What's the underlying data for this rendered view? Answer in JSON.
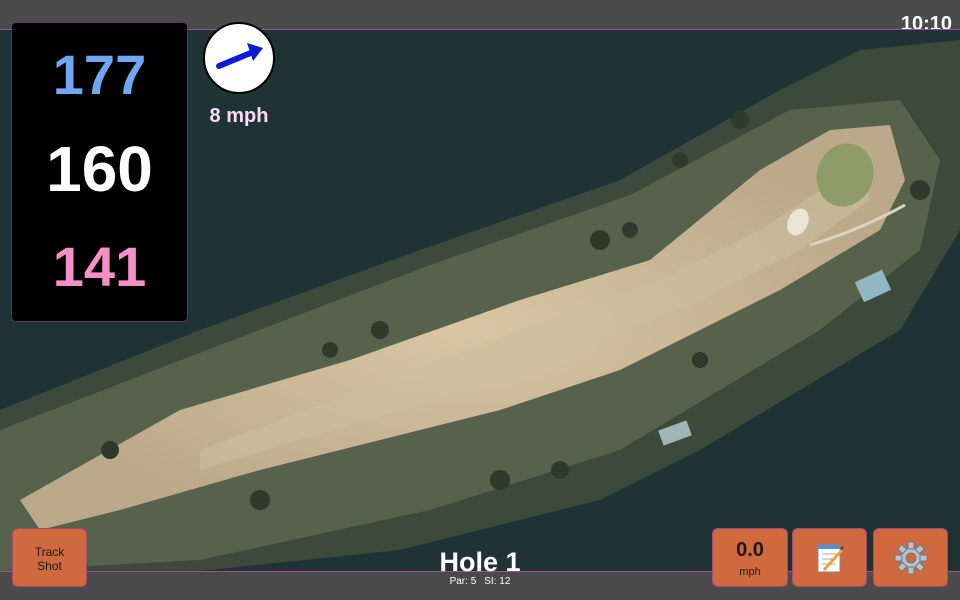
{
  "status_bar": {
    "time": "10:10"
  },
  "distances": {
    "back": "177",
    "center": "160",
    "front": "141"
  },
  "wind": {
    "speed": "8 mph",
    "arrow_color": "#0a1bd6"
  },
  "track_shot": {
    "line1": "Track",
    "line2": "Shot"
  },
  "speed": {
    "value": "0.0",
    "unit": "mph"
  },
  "notes": {
    "icon": "notepad-icon"
  },
  "settings": {
    "icon": "gear-icon"
  },
  "hole": {
    "title": "Hole 1",
    "par": "Par: 5",
    "si": "SI: 12"
  },
  "colors": {
    "accent_button": "#d1693e",
    "border_accent": "#a64d8f",
    "back_distance": "#6fa8f2",
    "front_distance": "#f48fc8"
  }
}
